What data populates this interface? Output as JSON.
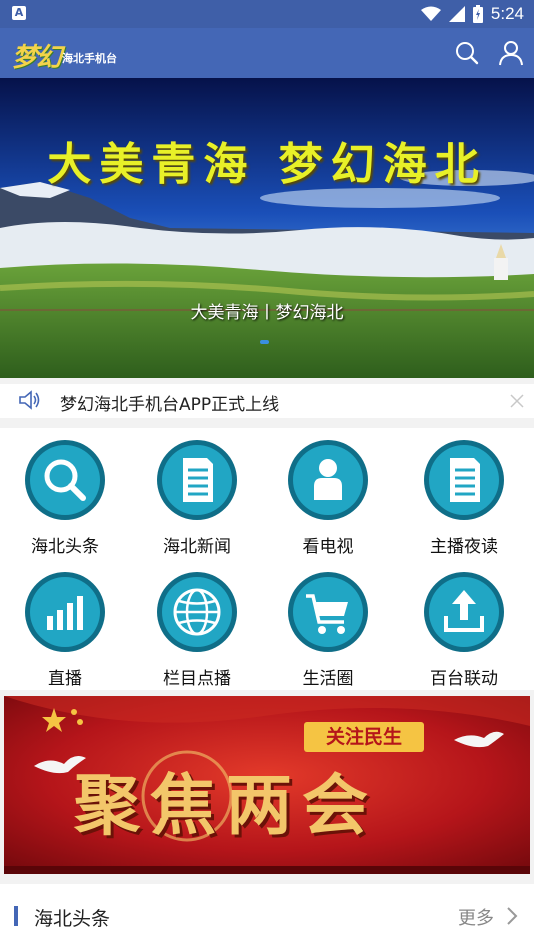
{
  "status_bar": {
    "time": "5:24",
    "app_indicator": "A"
  },
  "header": {
    "logo_mark": "梦幻",
    "logo_name": "海北手机台",
    "icons": [
      "search-icon",
      "user-icon"
    ]
  },
  "banner": {
    "headline": "大美青海  梦幻海北",
    "caption": "大美青海丨梦幻海北"
  },
  "notice": {
    "text": "梦幻海北手机台APP正式上线"
  },
  "grid": {
    "items": [
      {
        "label": "海北头条",
        "icon": "search-icon"
      },
      {
        "label": "海北新闻",
        "icon": "document-icon"
      },
      {
        "label": "看电视",
        "icon": "person-icon"
      },
      {
        "label": "主播夜读",
        "icon": "document-icon"
      },
      {
        "label": "直播",
        "icon": "bar-chart-icon"
      },
      {
        "label": "栏目点播",
        "icon": "globe-icon"
      },
      {
        "label": "生活圈",
        "icon": "cart-icon"
      },
      {
        "label": "百台联动",
        "icon": "upload-icon"
      }
    ]
  },
  "promo": {
    "title": "聚焦两会",
    "tag": "关注民生"
  },
  "section": {
    "title": "海北头条",
    "more": "更多"
  },
  "colors": {
    "header": "#4467b6",
    "status": "#3f5fa8",
    "icon_teal": "#1689a6",
    "promo_red": "#b5151a"
  }
}
